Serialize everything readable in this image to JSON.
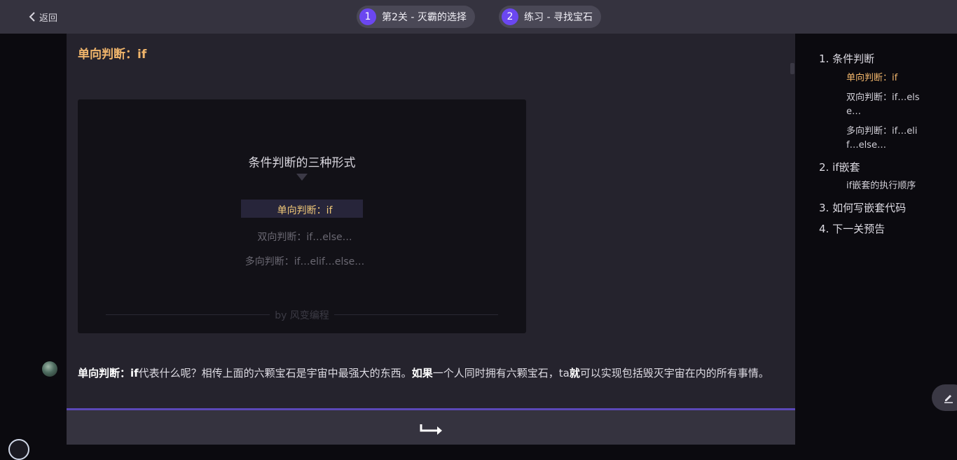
{
  "topbar": {
    "back_label": "返回",
    "steps": [
      {
        "num": "1",
        "label": "第2关 - 灭霸的选择"
      },
      {
        "num": "2",
        "label": "练习 - 寻找宝石"
      }
    ]
  },
  "content": {
    "section_title": "单向判断：if",
    "slide": {
      "title": "条件判断的三种形式",
      "items": [
        "单向判断：if",
        "双向判断：if…else…",
        "多向判断：if…elif…else…"
      ],
      "footer": "by 风变编程"
    },
    "paragraph": {
      "lead": "单向判断：if",
      "text1": "代表什么呢？相传上面的六颗宝石是宇宙中最强大的东西。",
      "bold2": "如果",
      "text2": "一个人同时拥有六颗宝石，ta",
      "bold3": "就",
      "text3": "可以实现包括毁灭宇宙在内的所有事情。"
    }
  },
  "toc": {
    "items": [
      {
        "label": "1. 条件判断"
      },
      {
        "label": "单向判断：if"
      },
      {
        "label": "双向判断：if…else…"
      },
      {
        "label": "多向判断：if…elif…else…"
      },
      {
        "label": "2. if嵌套"
      },
      {
        "label": "if嵌套的执行顺序"
      },
      {
        "label": "3. 如何写嵌套代码"
      },
      {
        "label": "4. 下一关预告"
      }
    ]
  },
  "icons": {
    "back": "chevron-left-icon",
    "next": "next-arrow-icon",
    "edit": "pencil-icon"
  },
  "colors": {
    "accent": "#6b47f0",
    "highlight": "#f0b56b",
    "topbar": "#35333f",
    "content_bg": "#25232d"
  }
}
